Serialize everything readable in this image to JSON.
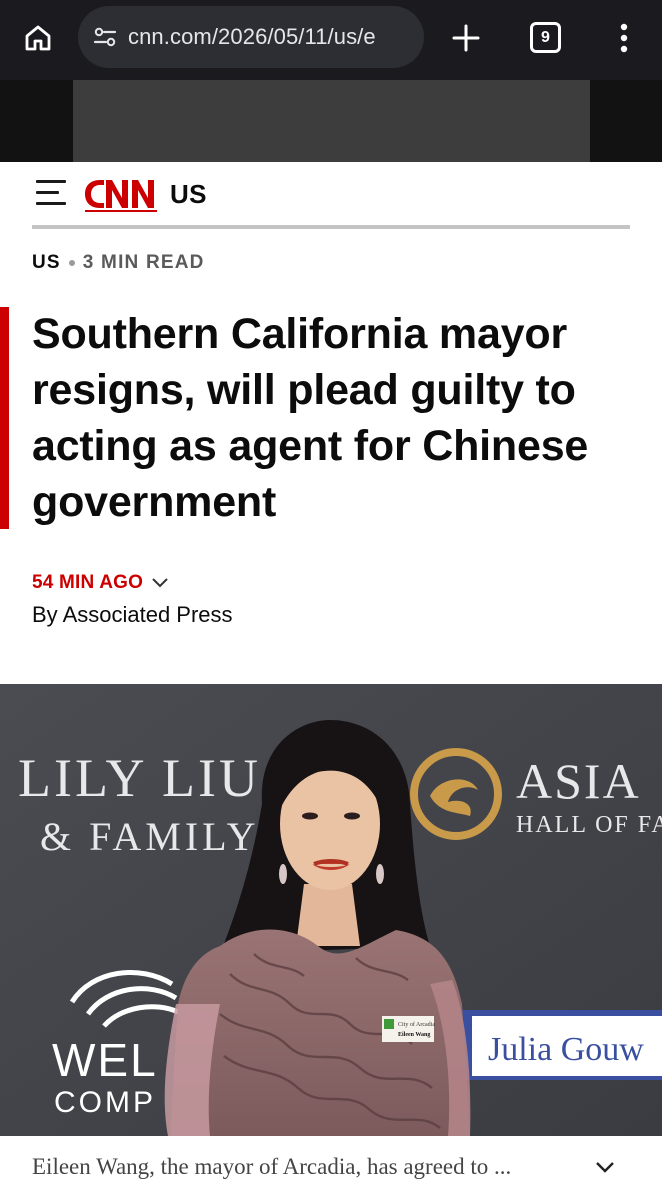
{
  "browser": {
    "url": "cnn.com/2026/05/11/us/e",
    "tab_count": "9"
  },
  "header": {
    "logo_text": "CNN",
    "section": "US"
  },
  "article": {
    "section_tag": "US",
    "read_time": "3 MIN READ",
    "headline": "Southern California mayor resigns, will plead guilty to acting as agent for Chinese government",
    "timestamp": "54 MIN AGO",
    "byline": "By Associated Press"
  },
  "photo": {
    "backdrop_left_line1": "LILY LIU",
    "backdrop_left_line2": "& FAMILY",
    "backdrop_right_line1": "ASIA",
    "backdrop_right_line2": "HALL OF FA",
    "backdrop_bottom_left_line1": "WEL",
    "backdrop_bottom_left_line2": "COMP",
    "name_card": "Julia Gouw",
    "badge_line1": "City of Arcadia",
    "badge_line2": "Eileen Wang"
  },
  "caption": {
    "text": "Eileen Wang, the mayor of Arcadia, has agreed to ..."
  },
  "colors": {
    "cnn_red": "#cc0000",
    "chrome_dark": "#1b1b1f",
    "omnibox": "#2d2e33"
  }
}
